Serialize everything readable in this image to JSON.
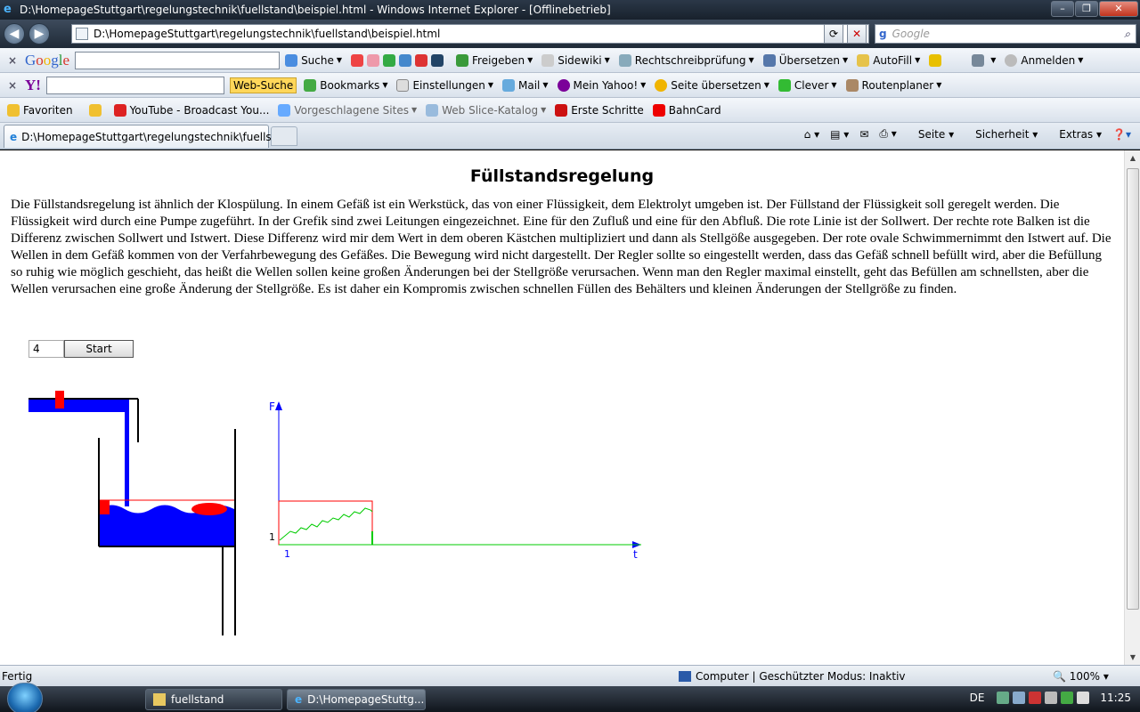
{
  "window": {
    "title": "D:\\HomepageStuttgart\\regelungstechnik\\fuellstand\\beispiel.html - Windows Internet Explorer - [Offlinebetrieb]",
    "minimize": "–",
    "maximize": "❐",
    "close": "✕"
  },
  "address": {
    "url": "D:\\HomepageStuttgart\\regelungstechnik\\fuellstand\\beispiel.html",
    "search_placeholder": "Google"
  },
  "google_toolbar": {
    "logo": "Google",
    "suche": "Suche",
    "freigeben": "Freigeben",
    "sidewiki": "Sidewiki",
    "rechtschreibpruefung": "Rechtschreibprüfung",
    "uebersetzen": "Übersetzen",
    "autofill": "AutoFill",
    "anmelden": "Anmelden"
  },
  "yahoo_toolbar": {
    "logo": "Y!",
    "web_suche": "Web-Suche",
    "bookmarks": "Bookmarks",
    "einstellungen": "Einstellungen",
    "mail": "Mail",
    "mein_yahoo": "Mein Yahoo!",
    "seite_uebersetzen": "Seite übersetzen",
    "clever": "Clever",
    "routenplaner": "Routenplaner"
  },
  "favorites_bar": {
    "favoriten": "Favoriten",
    "items": [
      "YouTube - Broadcast You...",
      "Vorgeschlagene Sites",
      "Web Slice-Katalog",
      "Erste Schritte",
      "BahnCard"
    ]
  },
  "tabs": {
    "active_label": "D:\\HomepageStuttgart\\regelungstechnik\\fuellsta..."
  },
  "commandbar": {
    "seite": "Seite",
    "sicherheit": "Sicherheit",
    "extras": "Extras"
  },
  "page": {
    "heading": "Füllstandsregelung",
    "body": "Die Füllstandsregelung ist ähnlich der Klospülung. In einem Gefäß ist ein Werkstück, das von einer Flüssigkeit, dem Elektrolyt umgeben ist. Der Füllstand der Flüssigkeit soll geregelt werden. Die Flüssigkeit wird durch eine Pumpe zugeführt. In der Grefik sind zwei Leitungen eingezeichnet. Eine für den Zufluß und eine für den Abfluß. Die rote Linie ist der Sollwert. Der rechte rote Balken ist die Differenz zwischen Sollwert und Istwert. Diese Differenz wird mir dem Wert in dem oberen Kästchen multipliziert und dann als Stellgöße ausgegeben. Der rote ovale Schwimmernimmt den Istwert auf. Die Wellen in dem Gefäß kommen von der Verfahrbewegung des Gefäßes. Die Bewegung wird nicht dargestellt. Der Regler sollte so eingestellt werden, dass das Gefäß schnell befüllt wird, aber die Befüllung so ruhig wie möglich geschieht, das heißt die Wellen sollen keine großen Änderungen bei der Stellgröße verursachen. Wenn man den Regler maximal einstellt, geht das Befüllen am schnellsten, aber die Wellen verursachen eine große Änderung der Stellgröße. Es ist daher ein Kompromis zwischen schnellen Füllen des Behälters und kleinen Änderungen der Stellgröße zu finden.",
    "gain_value": "4",
    "start_label": "Start"
  },
  "graph": {
    "y_axis_label": "F",
    "x_axis_label": "t",
    "y_tick": "1",
    "x_tick": "1",
    "colors": {
      "axis": "#0000ff",
      "setpoint": "#ff0000",
      "trace": "#00cc00",
      "water": "#0000ff"
    }
  },
  "statusbar": {
    "status": "Fertig",
    "mode": "Computer | Geschützter Modus: Inaktiv",
    "zoom": "100%"
  },
  "taskbar": {
    "items": [
      "fuellstand",
      "D:\\HomepageStuttg..."
    ],
    "lang": "DE",
    "clock": "11:25"
  }
}
